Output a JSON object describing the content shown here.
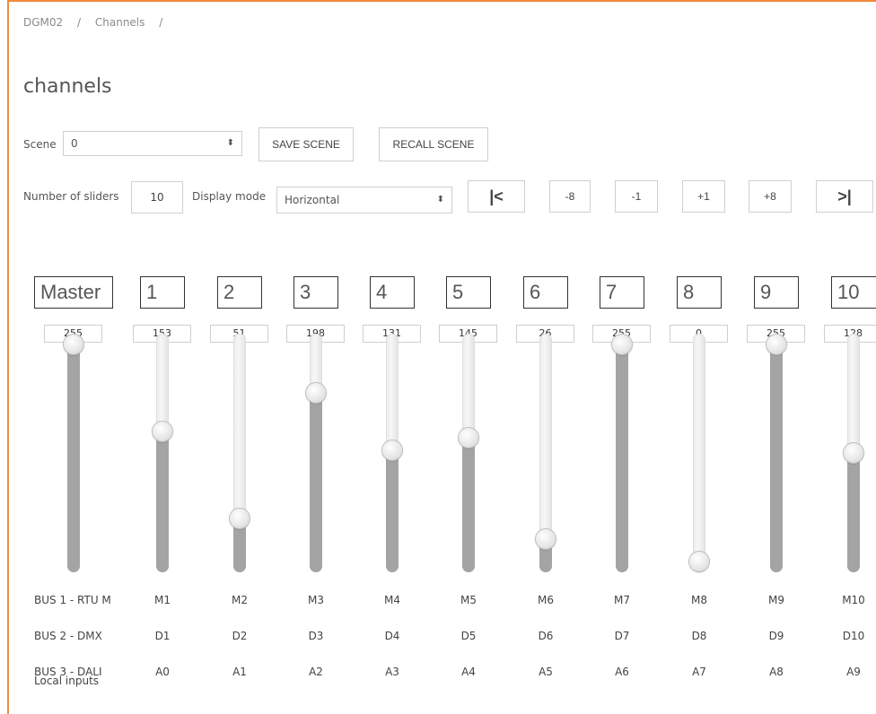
{
  "breadcrumb": {
    "device": "DGM02",
    "sep1": "/",
    "section": "Channels",
    "sep2": "/"
  },
  "page_title": "channels",
  "scene": {
    "label": "Scene",
    "value": "0",
    "save_label": "SAVE SCENE",
    "recall_label": "RECALL SCENE"
  },
  "controls": {
    "sliders_label": "Number of sliders",
    "sliders_value": "10",
    "display_label": "Display mode",
    "display_value": "Horizontal"
  },
  "nav": {
    "first": "|<",
    "m8": "-8",
    "m1": "-1",
    "p1": "+1",
    "p8": "+8",
    "last": ">|"
  },
  "channels": [
    {
      "label": "Master",
      "value": 255,
      "bus1": "BUS 1 - RTU M",
      "bus2": "BUS 2 - DMX",
      "bus3": "BUS 3 - DALI"
    },
    {
      "label": "1",
      "value": 153,
      "bus1": "M1",
      "bus2": "D1",
      "bus3": "A0"
    },
    {
      "label": "2",
      "value": 51,
      "bus1": "M2",
      "bus2": "D2",
      "bus3": "A1"
    },
    {
      "label": "3",
      "value": 198,
      "bus1": "M3",
      "bus2": "D3",
      "bus3": "A2"
    },
    {
      "label": "4",
      "value": 131,
      "bus1": "M4",
      "bus2": "D4",
      "bus3": "A3"
    },
    {
      "label": "5",
      "value": 145,
      "bus1": "M5",
      "bus2": "D5",
      "bus3": "A4"
    },
    {
      "label": "6",
      "value": 26,
      "bus1": "M6",
      "bus2": "D6",
      "bus3": "A5"
    },
    {
      "label": "7",
      "value": 255,
      "bus1": "M7",
      "bus2": "D7",
      "bus3": "A6"
    },
    {
      "label": "8",
      "value": 0,
      "bus1": "M8",
      "bus2": "D8",
      "bus3": "A7"
    },
    {
      "label": "9",
      "value": 255,
      "bus1": "M9",
      "bus2": "D9",
      "bus3": "A8"
    },
    {
      "label": "10",
      "value": 128,
      "bus1": "M10",
      "bus2": "D10",
      "bus3": "A9"
    }
  ],
  "local_inputs_label": "Local inputs",
  "colors": {
    "accent": "#ef8a3a",
    "fill": "#a4a4a4"
  }
}
